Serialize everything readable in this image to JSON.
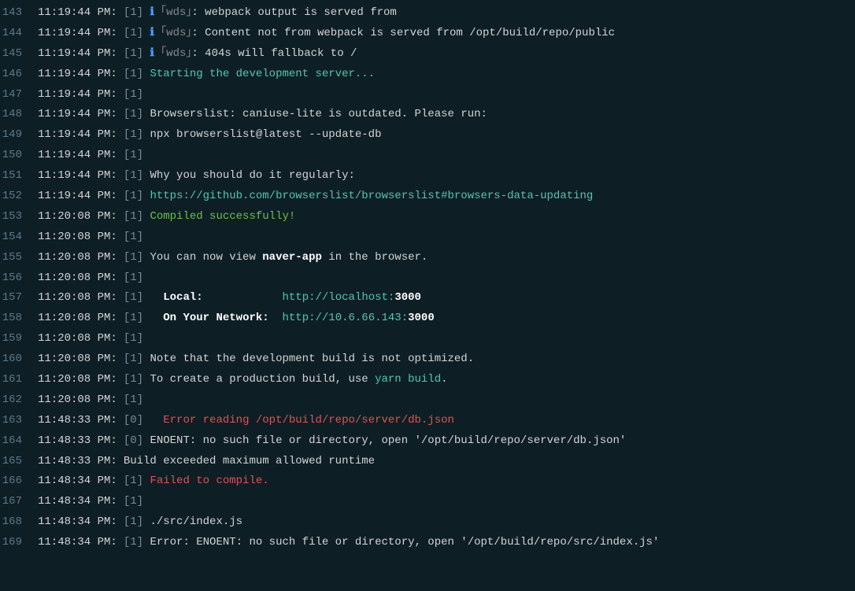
{
  "lines": [
    {
      "num": "143",
      "ts": "11:19:44 PM:",
      "prefix": "[1]",
      "segments": [
        {
          "cls": "info-icon",
          "text": "ℹ"
        },
        {
          "cls": "dim",
          "text": " ｢wds｣"
        },
        {
          "cls": "content",
          "text": ": webpack output is served from"
        }
      ]
    },
    {
      "num": "144",
      "ts": "11:19:44 PM:",
      "prefix": "[1]",
      "segments": [
        {
          "cls": "info-icon",
          "text": "ℹ"
        },
        {
          "cls": "dim",
          "text": " ｢wds｣"
        },
        {
          "cls": "content",
          "text": ": Content not from webpack is served from /opt/build/repo/public"
        }
      ]
    },
    {
      "num": "145",
      "ts": "11:19:44 PM:",
      "prefix": "[1]",
      "segments": [
        {
          "cls": "info-icon",
          "text": "ℹ"
        },
        {
          "cls": "dim",
          "text": " ｢wds｣"
        },
        {
          "cls": "content",
          "text": ": 404s will fallback to /"
        }
      ]
    },
    {
      "num": "146",
      "ts": "11:19:44 PM:",
      "prefix": "[1]",
      "segments": [
        {
          "cls": "teal",
          "text": "Starting the development server..."
        }
      ]
    },
    {
      "num": "147",
      "ts": "11:19:44 PM:",
      "prefix": "[1]",
      "segments": []
    },
    {
      "num": "148",
      "ts": "11:19:44 PM:",
      "prefix": "[1]",
      "segments": [
        {
          "cls": "content",
          "text": "Browserslist: caniuse-lite is outdated. Please run:"
        }
      ]
    },
    {
      "num": "149",
      "ts": "11:19:44 PM:",
      "prefix": "[1]",
      "segments": [
        {
          "cls": "content",
          "text": "npx browserslist@latest --update-db"
        }
      ]
    },
    {
      "num": "150",
      "ts": "11:19:44 PM:",
      "prefix": "[1]",
      "segments": []
    },
    {
      "num": "151",
      "ts": "11:19:44 PM:",
      "prefix": "[1]",
      "segments": [
        {
          "cls": "content",
          "text": "Why you should do it regularly:"
        }
      ]
    },
    {
      "num": "152",
      "ts": "11:19:44 PM:",
      "prefix": "[1]",
      "segments": [
        {
          "cls": "teal",
          "text": "https://github.com/browserslist/browserslist#browsers-data-updating"
        }
      ]
    },
    {
      "num": "153",
      "ts": "11:20:08 PM:",
      "prefix": "[1]",
      "segments": [
        {
          "cls": "green",
          "text": "Compiled successfully!"
        }
      ]
    },
    {
      "num": "154",
      "ts": "11:20:08 PM:",
      "prefix": "[1]",
      "segments": []
    },
    {
      "num": "155",
      "ts": "11:20:08 PM:",
      "prefix": "[1]",
      "segments": [
        {
          "cls": "content",
          "text": "You can now view "
        },
        {
          "cls": "bold",
          "text": "naver-app"
        },
        {
          "cls": "content",
          "text": " in the browser."
        }
      ]
    },
    {
      "num": "156",
      "ts": "11:20:08 PM:",
      "prefix": "[1]",
      "segments": []
    },
    {
      "num": "157",
      "ts": "11:20:08 PM:",
      "prefix": "[1]",
      "segments": [
        {
          "cls": "content",
          "text": "  "
        },
        {
          "cls": "bold",
          "text": "Local:"
        },
        {
          "cls": "content",
          "text": "            "
        },
        {
          "cls": "url-teal",
          "text": "http://localhost:"
        },
        {
          "cls": "bold",
          "text": "3000"
        }
      ]
    },
    {
      "num": "158",
      "ts": "11:20:08 PM:",
      "prefix": "[1]",
      "segments": [
        {
          "cls": "content",
          "text": "  "
        },
        {
          "cls": "bold",
          "text": "On Your Network:"
        },
        {
          "cls": "content",
          "text": "  "
        },
        {
          "cls": "url-teal",
          "text": "http://10.6.66.143:"
        },
        {
          "cls": "bold",
          "text": "3000"
        }
      ]
    },
    {
      "num": "159",
      "ts": "11:20:08 PM:",
      "prefix": "[1]",
      "segments": []
    },
    {
      "num": "160",
      "ts": "11:20:08 PM:",
      "prefix": "[1]",
      "segments": [
        {
          "cls": "content",
          "text": "Note that the development build is not optimized."
        }
      ]
    },
    {
      "num": "161",
      "ts": "11:20:08 PM:",
      "prefix": "[1]",
      "segments": [
        {
          "cls": "content",
          "text": "To create a production build, use "
        },
        {
          "cls": "cmd-highlight",
          "text": "yarn build"
        },
        {
          "cls": "content",
          "text": "."
        }
      ]
    },
    {
      "num": "162",
      "ts": "11:20:08 PM:",
      "prefix": "[1]",
      "segments": []
    },
    {
      "num": "163",
      "ts": "11:48:33 PM:",
      "prefix": "[0]",
      "segments": [
        {
          "cls": "content",
          "text": "  "
        },
        {
          "cls": "red",
          "text": "Error reading /opt/build/repo/server/db.json"
        }
      ]
    },
    {
      "num": "164",
      "ts": "11:48:33 PM:",
      "prefix": "[0]",
      "segments": [
        {
          "cls": "content",
          "text": "ENOENT: no such file or directory, open '/opt/build/repo/server/db.json'"
        }
      ]
    },
    {
      "num": "165",
      "ts": "11:48:33 PM:",
      "prefix": "",
      "segments": [
        {
          "cls": "content",
          "text": "Build exceeded maximum allowed runtime"
        }
      ],
      "noPrefix": true
    },
    {
      "num": "166",
      "ts": "11:48:34 PM:",
      "prefix": "[1]",
      "segments": [
        {
          "cls": "red",
          "text": "Failed to compile."
        }
      ]
    },
    {
      "num": "167",
      "ts": "11:48:34 PM:",
      "prefix": "[1]",
      "segments": []
    },
    {
      "num": "168",
      "ts": "11:48:34 PM:",
      "prefix": "[1]",
      "segments": [
        {
          "cls": "content",
          "text": "./src/index.js"
        }
      ]
    },
    {
      "num": "169",
      "ts": "11:48:34 PM:",
      "prefix": "[1]",
      "segments": [
        {
          "cls": "content",
          "text": "Error: ENOENT: no such file or directory, open '/opt/build/repo/src/index.js'"
        }
      ]
    }
  ]
}
